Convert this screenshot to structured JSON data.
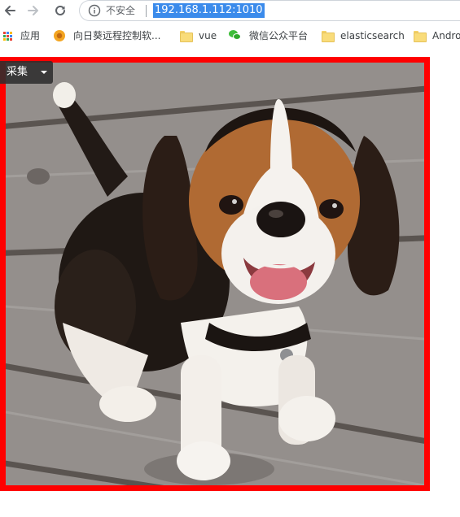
{
  "toolbar": {
    "back_icon": "arrow-left-icon",
    "forward_icon": "arrow-right-icon",
    "reload_icon": "reload-icon",
    "security_icon": "info-circle-icon",
    "security_label": "不安全",
    "url": "192.168.1.112:1010",
    "url_highlight_color": "#3b8beb"
  },
  "bookmarks": {
    "items": [
      {
        "label": "应用",
        "icon": "apps-grid-icon"
      },
      {
        "label": "向日葵远程控制软...",
        "icon": "sunflower-icon"
      },
      {
        "label": "vue",
        "icon": "folder-icon"
      },
      {
        "label": "微信公众平台",
        "icon": "wechat-icon"
      },
      {
        "label": "elasticsearch",
        "icon": "folder-icon"
      },
      {
        "label": "Andro",
        "icon": "folder-icon"
      }
    ]
  },
  "content": {
    "collect_button": {
      "label": "采集",
      "icon": "caret-down-icon"
    },
    "frame_color": "#ff0000",
    "image_subject": "beagle-puppy-photo"
  }
}
